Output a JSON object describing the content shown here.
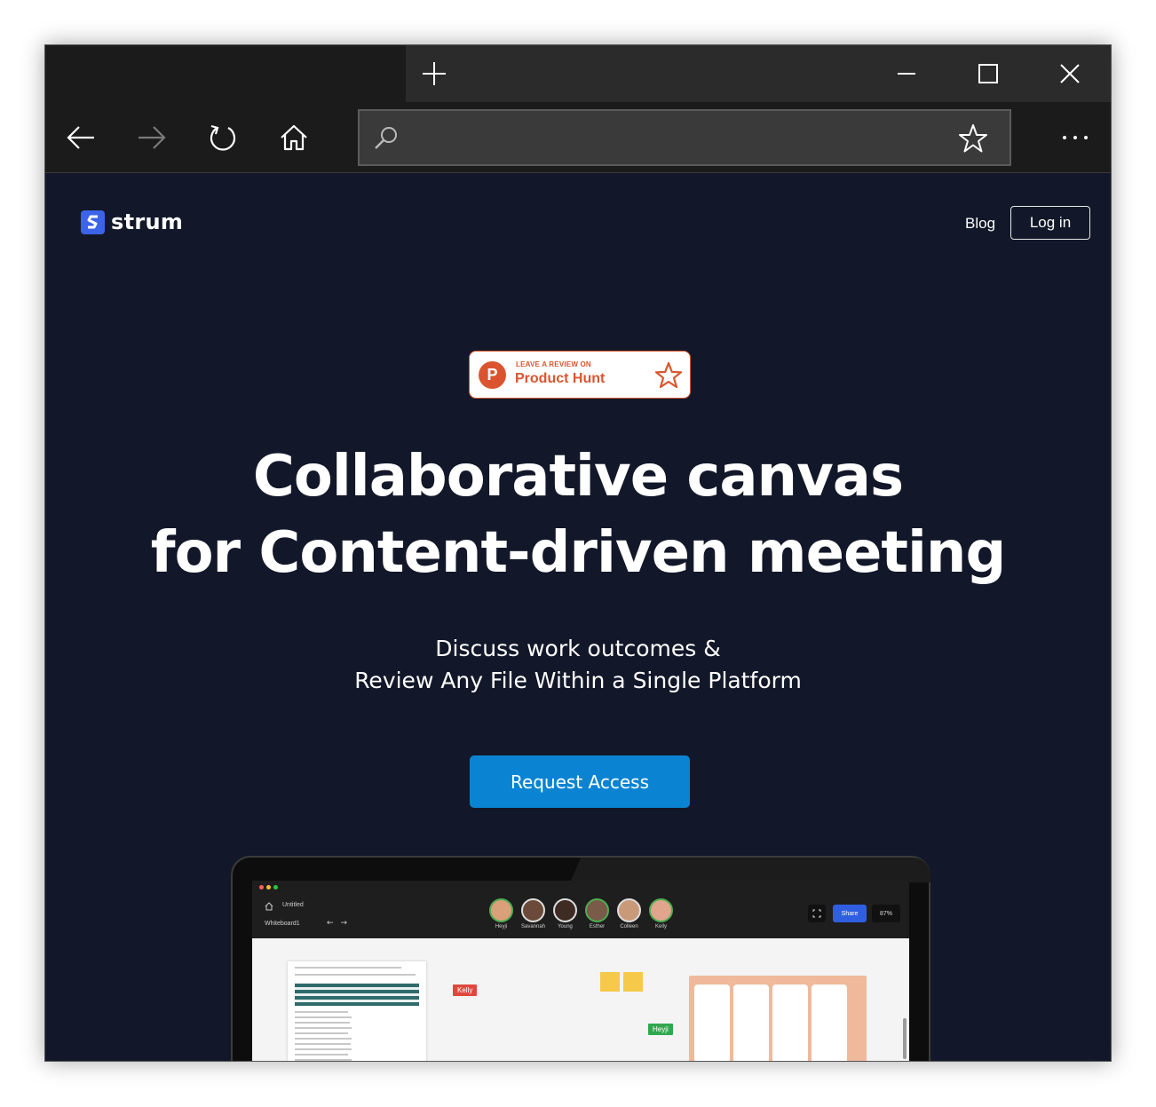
{
  "browser": {
    "new_tab_icon": "plus-icon",
    "window_controls": [
      "minimize-icon",
      "maximize-icon",
      "close-icon"
    ],
    "nav_icons": [
      "back-arrow-icon",
      "forward-arrow-icon",
      "refresh-icon",
      "home-icon"
    ],
    "address": {
      "value": "",
      "search_icon": "search-icon",
      "favorite_icon": "star-icon"
    },
    "more_icon": "more-dots-icon"
  },
  "site": {
    "logo_text": "strum",
    "nav": {
      "blog": "Blog",
      "login": "Log in"
    },
    "badge": {
      "small": "LEAVE A REVIEW ON",
      "big": "Product Hunt",
      "letter": "P"
    },
    "hero": {
      "title_line1": "Collaborative canvas",
      "title_line2": "for Content-driven meeting",
      "sub_line1": "Discuss work outcomes &",
      "sub_line2": "Review Any File Within a Single Platform"
    },
    "cta": "Request Access"
  },
  "app_preview": {
    "doc_title": "Untitled",
    "board": "Whiteboard1",
    "participants": [
      "Heyji",
      "Savannah",
      "Young",
      "Esther",
      "Colleen",
      "Kelly"
    ],
    "share": "Share",
    "zoom": "87%",
    "cursors": [
      {
        "name": "Kelly",
        "color": "#e0483e"
      },
      {
        "name": "Heyji",
        "color": "#2fa84f"
      }
    ],
    "colors": {
      "accent": "#0a84d2",
      "brand": "#3b64e8",
      "product_hunt": "#da552f",
      "page_bg": "#121829"
    }
  }
}
